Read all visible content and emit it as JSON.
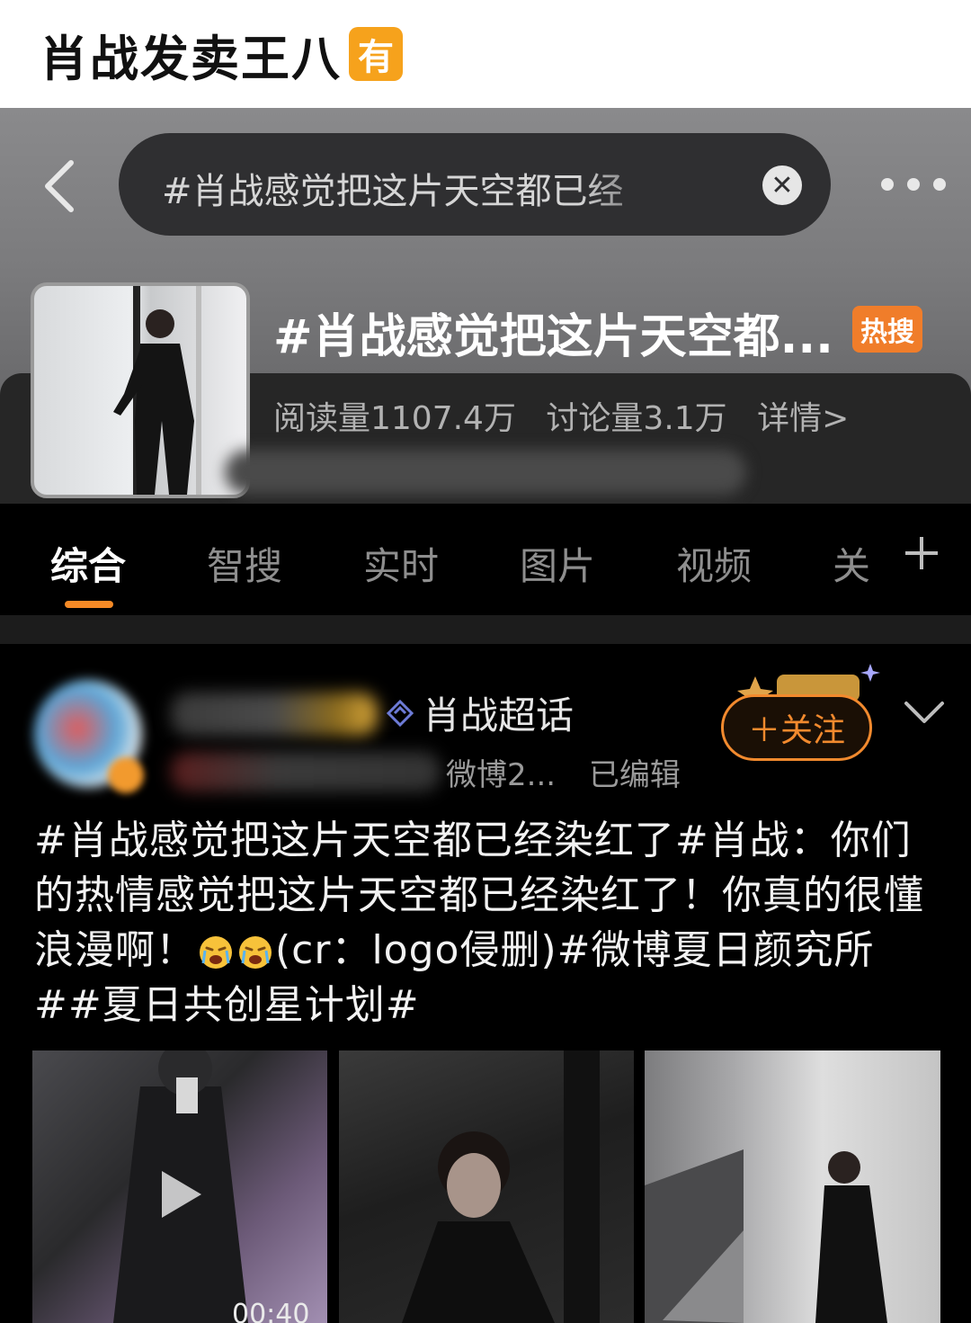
{
  "caption": {
    "text": "肖战发卖王八",
    "badge": "有"
  },
  "header": {
    "search_text": "#肖战感觉把这片天空都已经",
    "topic_title": "#肖战感觉把这片天空都...",
    "hot_badge": "热搜",
    "stats": {
      "reads": "阅读量1107.4万",
      "discussions": "讨论量3.1万",
      "details": "详情>"
    }
  },
  "tabs": [
    {
      "label": "综合",
      "active": true
    },
    {
      "label": "智搜"
    },
    {
      "label": "实时"
    },
    {
      "label": "图片"
    },
    {
      "label": "视频"
    },
    {
      "label": "关"
    }
  ],
  "post": {
    "supertopic": "肖战超话",
    "meta": {
      "source": "微博2...",
      "edited": "已编辑"
    },
    "follow_label": "＋关注",
    "text_part1": "#肖战感觉把这片天空都已经染红了#肖战：你们的热情感觉把这片天空都已经染红了！你真的很懂浪漫啊！",
    "text_part2": "(cr：logo侵删)#微博夏日颜究所##夏日共创星计划#",
    "video_duration": "00:40"
  },
  "colors": {
    "accent": "#f58a26",
    "caption_badge": "#f6a21c",
    "hot_badge": "#f07d2a"
  },
  "icons": [
    "back-chevron-icon",
    "clear-icon",
    "more-dots-icon",
    "plus-icon",
    "chevron-down-icon",
    "play-icon",
    "crying-emoji-icon",
    "supertopic-diamond-icon"
  ]
}
